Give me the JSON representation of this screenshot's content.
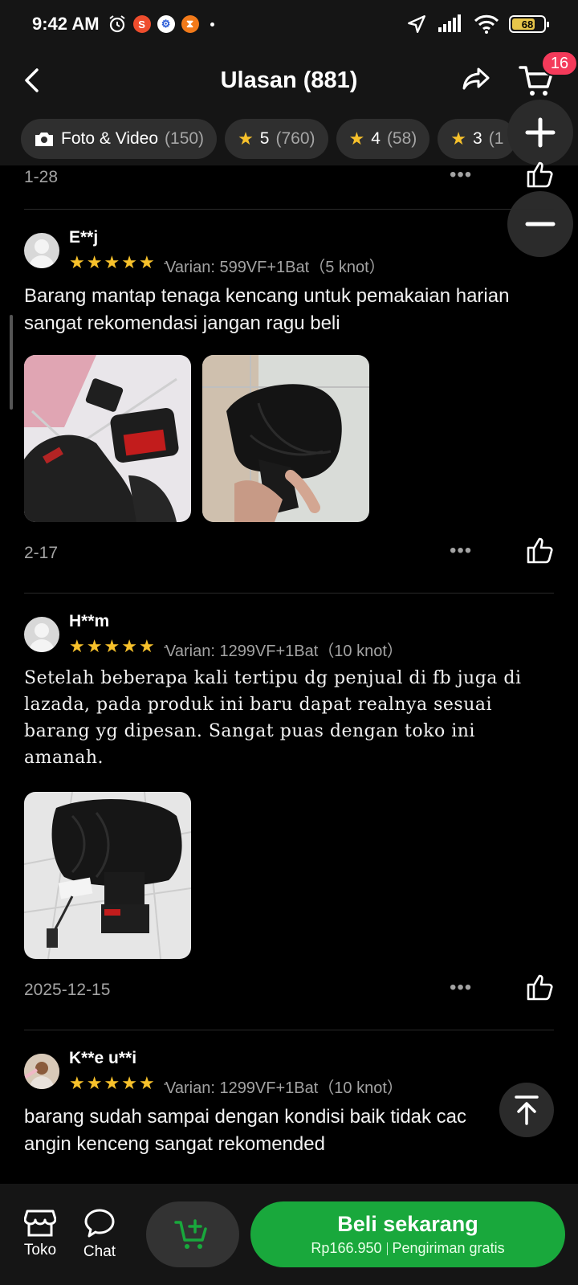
{
  "status_bar": {
    "time": "9:42 AM",
    "battery": "68"
  },
  "header": {
    "title": "Ulasan (881)",
    "cart_badge": "16"
  },
  "filters": [
    {
      "label": "Foto & Video",
      "count": "(150)"
    },
    {
      "label": "5",
      "count": "(760)"
    },
    {
      "label": "4",
      "count": "(58)"
    },
    {
      "label": "3",
      "count": "(1"
    }
  ],
  "top_partial": {
    "date": "1-28"
  },
  "reviews": [
    {
      "user": "E**j",
      "variant": "Varian: 599VF+1Bat（5 knot）",
      "text": "Barang mantap tenaga kencang untuk pemakaian harian sangat rekomendasi jangan ragu beli",
      "date": "2-17"
    },
    {
      "user": "H**m",
      "variant": "Varian: 1299VF+1Bat（10 knot）",
      "text": "Setelah beberapa kali tertipu dg penjual di fb juga di lazada, pada produk ini baru dapat realnya sesuai barang yg dipesan. Sangat puas dengan toko ini amanah.",
      "date": "2025-12-15"
    },
    {
      "user": "K**e u**i",
      "variant": "Varian: 1299VF+1Bat（10 knot）",
      "text": "barang sudah sampai dengan kondisi baik tidak cac angin kenceng sangat rekomended"
    }
  ],
  "more_label": "•••",
  "bottom_bar": {
    "store_label": "Toko",
    "chat_label": "Chat",
    "buy_label": "Beli sekarang",
    "price": "Rp166.950",
    "shipping": "Pengiriman gratis"
  },
  "colors": {
    "accent_green": "#19a83c",
    "star": "#f7c12b",
    "badge": "#f43a5a"
  }
}
